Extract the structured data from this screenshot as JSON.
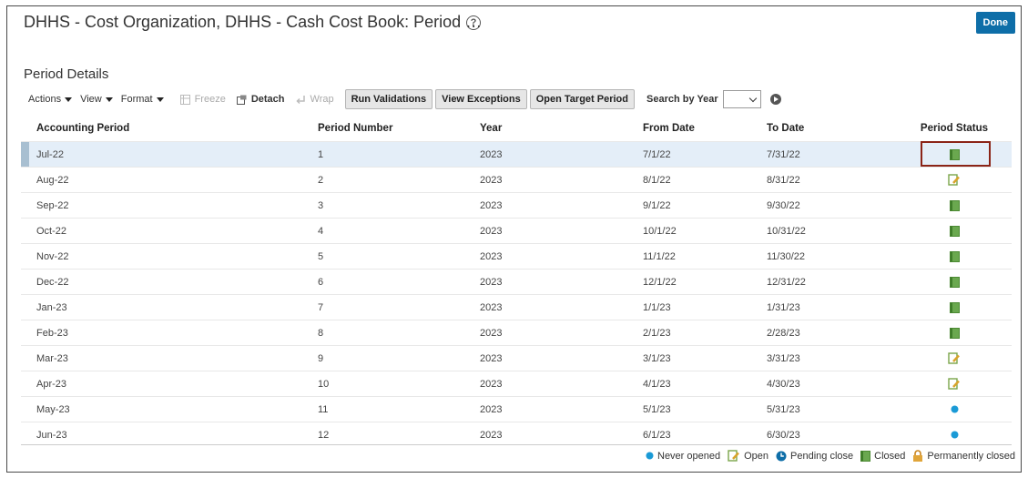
{
  "header": {
    "title": "DHHS - Cost Organization, DHHS - Cash Cost Book: Period …",
    "help_icon": "?",
    "done_label": "Done"
  },
  "section_title": "Period Details",
  "toolbar": {
    "actions_label": "Actions",
    "view_label": "View",
    "format_label": "Format",
    "freeze_label": "Freeze",
    "detach_label": "Detach",
    "wrap_label": "Wrap",
    "run_validations_label": "Run Validations",
    "view_exceptions_label": "View Exceptions",
    "open_target_period_label": "Open Target Period",
    "search_by_year_label": "Search by Year",
    "search_by_year_value": ""
  },
  "table": {
    "columns": [
      "Accounting Period",
      "Period Number",
      "Year",
      "From Date",
      "To Date",
      "Period Status"
    ],
    "rows": [
      {
        "period": "Jul-22",
        "number": "1",
        "year": "2023",
        "from": "7/1/22",
        "to": "7/31/22",
        "status": "closed"
      },
      {
        "period": "Aug-22",
        "number": "2",
        "year": "2023",
        "from": "8/1/22",
        "to": "8/31/22",
        "status": "open"
      },
      {
        "period": "Sep-22",
        "number": "3",
        "year": "2023",
        "from": "9/1/22",
        "to": "9/30/22",
        "status": "closed"
      },
      {
        "period": "Oct-22",
        "number": "4",
        "year": "2023",
        "from": "10/1/22",
        "to": "10/31/22",
        "status": "closed"
      },
      {
        "period": "Nov-22",
        "number": "5",
        "year": "2023",
        "from": "11/1/22",
        "to": "11/30/22",
        "status": "closed"
      },
      {
        "period": "Dec-22",
        "number": "6",
        "year": "2023",
        "from": "12/1/22",
        "to": "12/31/22",
        "status": "closed"
      },
      {
        "period": "Jan-23",
        "number": "7",
        "year": "2023",
        "from": "1/1/23",
        "to": "1/31/23",
        "status": "closed"
      },
      {
        "period": "Feb-23",
        "number": "8",
        "year": "2023",
        "from": "2/1/23",
        "to": "2/28/23",
        "status": "closed"
      },
      {
        "period": "Mar-23",
        "number": "9",
        "year": "2023",
        "from": "3/1/23",
        "to": "3/31/23",
        "status": "open"
      },
      {
        "period": "Apr-23",
        "number": "10",
        "year": "2023",
        "from": "4/1/23",
        "to": "4/30/23",
        "status": "open"
      },
      {
        "period": "May-23",
        "number": "11",
        "year": "2023",
        "from": "5/1/23",
        "to": "5/31/23",
        "status": "never-opened"
      },
      {
        "period": "Jun-23",
        "number": "12",
        "year": "2023",
        "from": "6/1/23",
        "to": "6/30/23",
        "status": "never-opened"
      }
    ],
    "selected_row_index": 0
  },
  "legend": {
    "never_opened": "Never opened",
    "open": "Open",
    "pending_close": "Pending close",
    "closed": "Closed",
    "permanently_closed": "Permanently closed"
  },
  "colors": {
    "done_button": "#0e6ea8",
    "closed_icon": "#6aa84f",
    "open_icon": "#d9a32b",
    "never_opened_dot": "#1a9ad6",
    "highlight_box": "#8b2417",
    "selected_row": "#e4eef8"
  }
}
